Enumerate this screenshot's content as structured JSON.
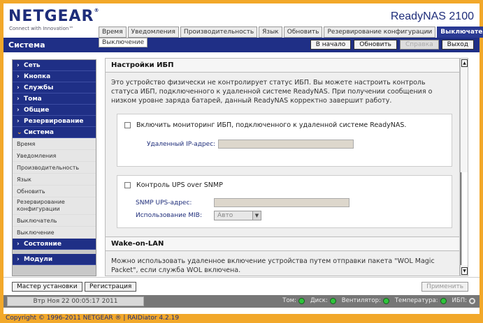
{
  "brand": {
    "logo": "NETGEAR",
    "tagline": "Connect with Innovation™",
    "product": "ReadyNAS 2100"
  },
  "tabs": [
    "Время",
    "Уведомления",
    "Производительность",
    "Язык",
    "Обновить",
    "Резервирование конфигурации",
    "Выключатель"
  ],
  "active_tab": "Выключатель",
  "subtab": "Выключение",
  "page_title": "Система",
  "nav_buttons": {
    "home": "В начало",
    "refresh": "Обновить",
    "help": "Справка",
    "logout": "Выход"
  },
  "sidebar": {
    "cat_network": "Сеть",
    "cat_button": "Кнопка",
    "cat_services": "Службы",
    "cat_volumes": "Тома",
    "cat_shares": "Общие",
    "cat_backup": "Резервирование",
    "cat_system": "Система",
    "items": [
      "Время",
      "Уведомления",
      "Производительность",
      "Язык",
      "Обновить",
      "Резервирование конфигурации",
      "Выключатель",
      "Выключение"
    ],
    "cat_status": "Состояние",
    "cat_modules": "Модули"
  },
  "ups": {
    "section_title": "Настройки ИБП",
    "description": "Это устройство физически не контролирует статус ИБП. Вы можете настроить контроль статуса ИБП, подключенного к удаленной системе ReadyNAS. При получении сообщения о низком уровне заряда батарей, данный ReadyNAS корректно завершит работу.",
    "remote_check_label": "Включить мониторинг ИБП, подключенного к удаленной системе ReadyNAS.",
    "remote_ip_label": "Удаленный IP-адрес:",
    "remote_ip_value": "",
    "snmp_check_label": "Контроль UPS over SNMP",
    "snmp_addr_label": "SNMP UPS-адрес:",
    "snmp_addr_value": "",
    "mib_label": "Использование MIB:",
    "mib_value": "Авто"
  },
  "wol": {
    "section_title": "Wake-on-LAN",
    "description": "Можно использовать удаленное включение устройства путем отправки пакета \"WOL Magic Packet\", если служба WOL включена."
  },
  "bottom": {
    "wizard": "Мастер установки",
    "register": "Регистрация",
    "apply": "Применить"
  },
  "status": {
    "datetime": "Втр Ноя 22  00:05:17 2011",
    "volume": "Том:",
    "disk": "Диск:",
    "fan": "Вентилятор:",
    "temp": "Температура:",
    "ups": "ИБП:"
  },
  "copyright": "Copyright © 1996-2011 NETGEAR ® | RAIDiator 4.2.19",
  "colors": {
    "brand_blue": "#1f2f86",
    "frame_orange": "#f2a82a",
    "status_ok": "#2ec43b"
  }
}
